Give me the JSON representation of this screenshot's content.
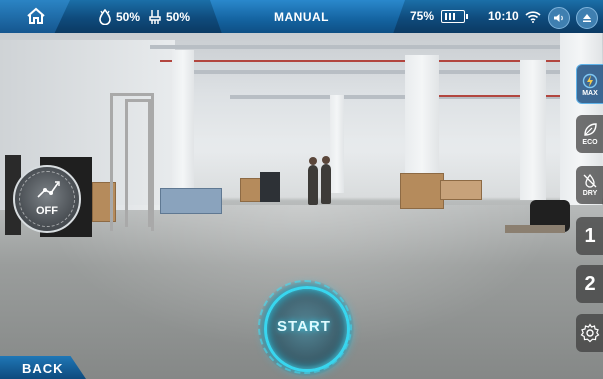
{
  "header": {
    "battery_a_percent": "50%",
    "battery_b_percent": "50%",
    "mode": "MANUAL",
    "battery_level": "75%",
    "time": "10:10"
  },
  "icons": {
    "home": "home-icon",
    "water": "water-drop-icon",
    "brush": "brush-icon",
    "battery": "battery-icon",
    "wifi": "wifi-icon",
    "volume": "volume-icon",
    "eject": "eject-icon",
    "power": "power-icon",
    "settings": "gear-icon"
  },
  "side_buttons": {
    "max": "MAX",
    "eco": "ECO",
    "dry": "DRY",
    "speed1": "1",
    "speed2": "2"
  },
  "controls": {
    "power_toggle": "OFF",
    "start": "START",
    "back": "BACK"
  },
  "colors": {
    "accent_blue": "#1463a0",
    "start_cyan": "#38d6ef"
  }
}
